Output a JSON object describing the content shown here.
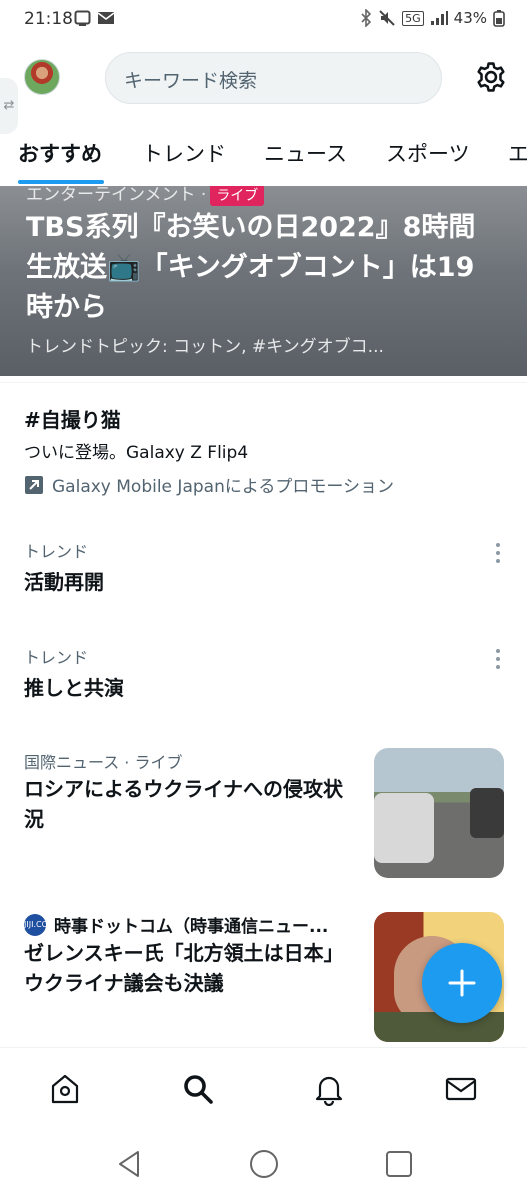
{
  "status_bar": {
    "time": "21:18",
    "network": "5G",
    "battery": "43%",
    "icons_left": [
      "cast-icon",
      "mail-icon"
    ],
    "icons_right": [
      "bluetooth-icon",
      "mute-icon",
      "signal-icon",
      "battery-icon"
    ]
  },
  "header": {
    "search_placeholder": "キーワード検索",
    "side_handle": "⇄"
  },
  "tabs": [
    {
      "label": "おすすめ",
      "active": true
    },
    {
      "label": "トレンド",
      "active": false
    },
    {
      "label": "ニュース",
      "active": false
    },
    {
      "label": "スポーツ",
      "active": false
    },
    {
      "label": "エ",
      "active": false
    }
  ],
  "hero": {
    "category": "エンターテインメント ·",
    "live_label": "ライブ",
    "title": "TBS系列『お笑いの日2022』8時間生放送📺「キングオブコント」は19時から",
    "subtitle": "トレンドトピック: コットン, #キングオブコ..."
  },
  "promoted": {
    "title": "#自撮り猫",
    "text": "ついに登場。Galaxy Z Flip4",
    "promoter": "Galaxy Mobile Japanによるプロモーション"
  },
  "trends": [
    {
      "label": "トレンド",
      "name": "活動再開"
    },
    {
      "label": "トレンド",
      "name": "推しと共演"
    }
  ],
  "news": [
    {
      "meta": "国際ニュース · ライブ",
      "title": "ロシアによるウクライナへの侵攻状況"
    },
    {
      "source_badge": "JIJI.COM",
      "source": "時事ドットコム（時事通信ニュー...",
      "title": "ゼレンスキー氏「北方領土は日本」　ウクライナ議会も決議"
    }
  ],
  "colors": {
    "accent": "#1d9bf0",
    "text": "#0f1419",
    "secondary_text": "#536471",
    "live_badge": "#e0245e"
  }
}
